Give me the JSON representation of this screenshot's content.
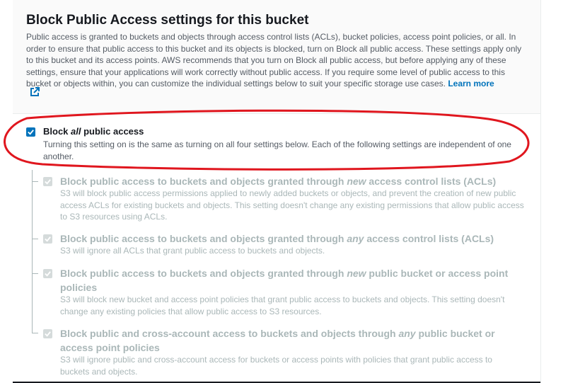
{
  "section": {
    "title": "Block Public Access settings for this bucket",
    "description": "Public access is granted to buckets and objects through access control lists (ACLs), bucket policies, access point policies, or all. In order to ensure that public access to this bucket and its objects is blocked, turn on Block all public access. These settings apply only to this bucket and its access points. AWS recommends that you turn on Block all public access, but before applying any of these settings, ensure that your applications will work correctly without public access. If you require some level of public access to this bucket or objects within, you can customize the individual settings below to suit your specific storage use cases.",
    "learn_more": "Learn more",
    "external_icon": "external-link-icon"
  },
  "block_all": {
    "title_prefix": "Block ",
    "title_em": "all",
    "title_suffix": " public access",
    "description": "Turning this setting on is the same as turning on all four settings below. Each of the following settings are independent of one another.",
    "checked": true
  },
  "settings": [
    {
      "title_prefix": "Block public access to buckets and objects granted through ",
      "title_em": "new",
      "title_suffix": " access control lists (ACLs)",
      "description": "S3 will block public access permissions applied to newly added buckets or objects, and prevent the creation of new public access ACLs for existing buckets and objects. This setting doesn't change any existing permissions that allow public access to S3 resources using ACLs.",
      "checked": true,
      "disabled": true
    },
    {
      "title_prefix": "Block public access to buckets and objects granted through ",
      "title_em": "any",
      "title_suffix": " access control lists (ACLs)",
      "description": "S3 will ignore all ACLs that grant public access to buckets and objects.",
      "checked": true,
      "disabled": true
    },
    {
      "title_prefix": "Block public access to buckets and objects granted through ",
      "title_em": "new",
      "title_suffix": " public bucket or access point policies",
      "description": "S3 will block new bucket and access point policies that grant public access to buckets and objects. This setting doesn't change any existing policies that allow public access to S3 resources.",
      "checked": true,
      "disabled": true
    },
    {
      "title_prefix": "Block public and cross-account access to buckets and objects through ",
      "title_em": "any",
      "title_suffix": " public bucket or access point policies",
      "description": "S3 will ignore public and cross-account access for buckets or access points with policies that grant public access to buckets and objects.",
      "checked": true,
      "disabled": true
    }
  ],
  "colors": {
    "accent": "#0073bb",
    "annotation": "#e0161e",
    "disabled_text": "#aab7b8"
  }
}
